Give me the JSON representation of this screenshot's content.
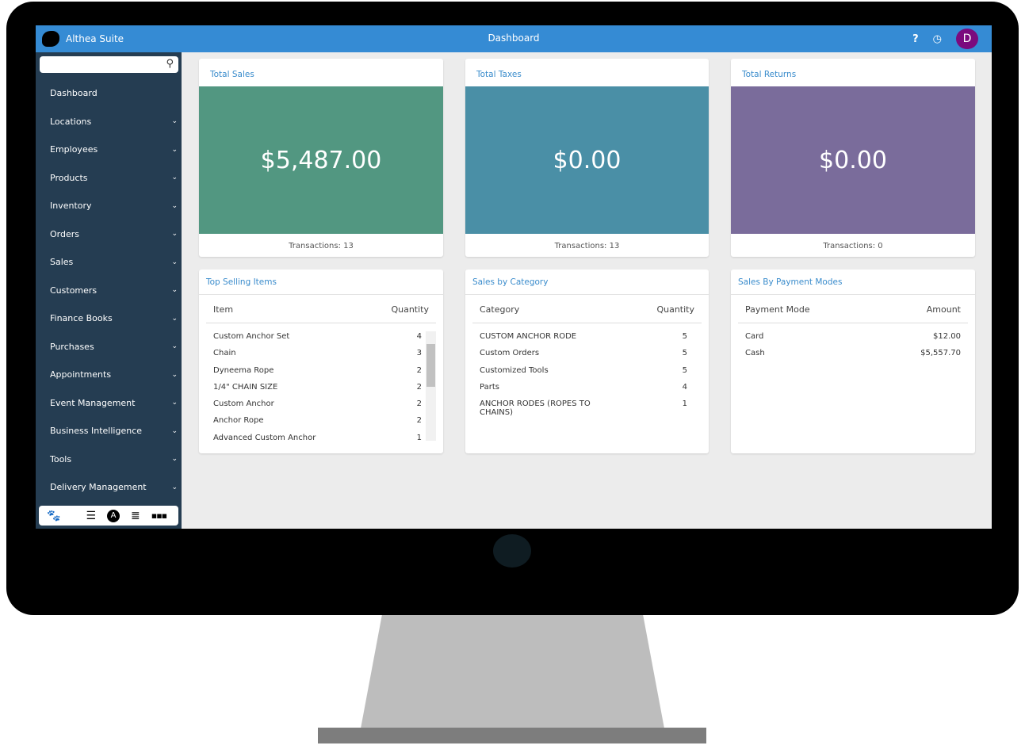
{
  "app": {
    "name": "Althea Suite",
    "page_title": "Dashboard",
    "avatar_letter": "D"
  },
  "sidebar": {
    "search_placeholder": "",
    "items": [
      {
        "label": "Dashboard",
        "expandable": false
      },
      {
        "label": "Locations",
        "expandable": true
      },
      {
        "label": "Employees",
        "expandable": true
      },
      {
        "label": "Products",
        "expandable": true
      },
      {
        "label": "Inventory",
        "expandable": true
      },
      {
        "label": "Orders",
        "expandable": true
      },
      {
        "label": "Sales",
        "expandable": true
      },
      {
        "label": "Customers",
        "expandable": true
      },
      {
        "label": "Finance Books",
        "expandable": true
      },
      {
        "label": "Purchases",
        "expandable": true
      },
      {
        "label": "Appointments",
        "expandable": true
      },
      {
        "label": "Event Management",
        "expandable": true
      },
      {
        "label": "Business Intelligence",
        "expandable": true
      },
      {
        "label": "Tools",
        "expandable": true
      },
      {
        "label": "Delivery Management",
        "expandable": true
      }
    ]
  },
  "summary": [
    {
      "title": "Total Sales",
      "value": "$5,487.00",
      "footer": "Transactions: 13",
      "color": "#529781"
    },
    {
      "title": "Total Taxes",
      "value": "$0.00",
      "footer": "Transactions: 13",
      "color": "#4a8fa6"
    },
    {
      "title": "Total Returns",
      "value": "$0.00",
      "footer": "Transactions: 0",
      "color": "#7a6c9b"
    }
  ],
  "top_selling": {
    "title": "Top Selling Items",
    "col1": "Item",
    "col2": "Quantity",
    "rows": [
      [
        "Custom Anchor Set",
        "4"
      ],
      [
        "Chain",
        "3"
      ],
      [
        "Dyneema Rope",
        "2"
      ],
      [
        "1/4\" CHAIN SIZE",
        "2"
      ],
      [
        "Custom Anchor",
        "2"
      ],
      [
        "Anchor Rope",
        "2"
      ],
      [
        "Advanced Custom Anchor",
        "1"
      ]
    ]
  },
  "by_category": {
    "title": "Sales by Category",
    "col1": "Category",
    "col2": "Quantity",
    "rows": [
      [
        "CUSTOM ANCHOR RODE",
        "5"
      ],
      [
        "Custom Orders",
        "5"
      ],
      [
        "Customized Tools",
        "5"
      ],
      [
        "Parts",
        "4"
      ],
      [
        "ANCHOR RODES (ROPES TO CHAINS)",
        "1"
      ]
    ]
  },
  "by_payment": {
    "title": "Sales By Payment Modes",
    "col1": "Payment Mode",
    "col2": "Amount",
    "rows": [
      [
        "Card",
        "$12.00"
      ],
      [
        "Cash",
        "$5,557.70"
      ]
    ]
  }
}
